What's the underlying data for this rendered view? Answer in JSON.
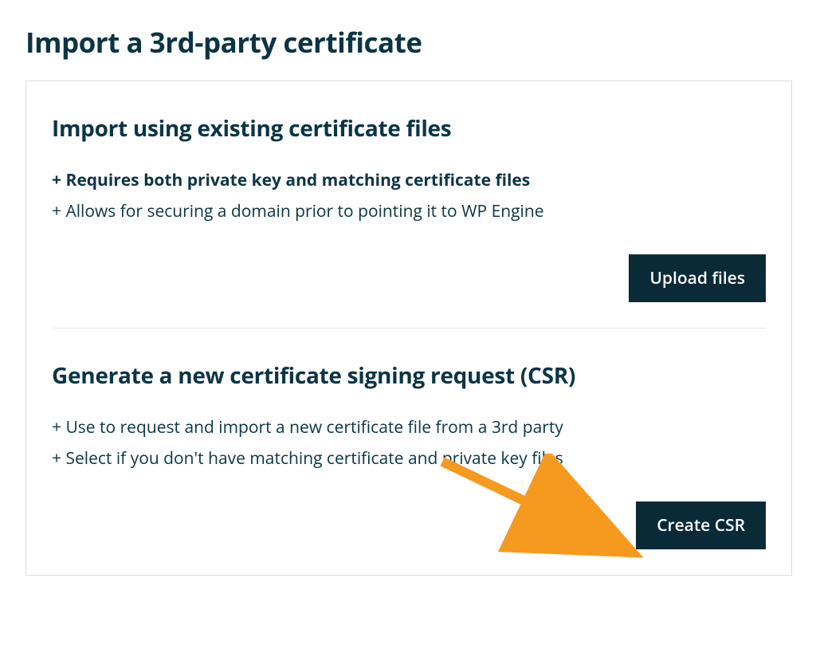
{
  "page": {
    "title": "Import a 3rd-party certificate"
  },
  "sections": {
    "import_existing": {
      "title": "Import using existing certificate files",
      "bullets": [
        "+ Requires both private key and matching certificate files",
        "+ Allows for securing a domain prior to pointing it to WP Engine"
      ],
      "button_label": "Upload files"
    },
    "generate_csr": {
      "title": "Generate a new certificate signing request (CSR)",
      "bullets": [
        "+ Use to request and import a new certificate file from a 3rd party",
        "+ Select if you don't have matching certificate and private key files"
      ],
      "button_label": "Create CSR"
    }
  },
  "colors": {
    "text": "#0b3545",
    "button_bg": "#0b2a38",
    "button_text": "#ffffff",
    "border": "#d9dcde",
    "arrow": "#f59a1f"
  }
}
